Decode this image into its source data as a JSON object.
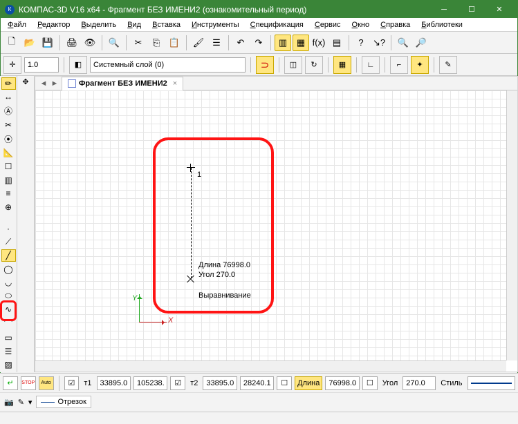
{
  "window": {
    "title": "КОМПАС-3D V16  x64 - Фрагмент БЕЗ ИМЕНИ2 (ознакомительный период)"
  },
  "menu": {
    "items": [
      "Файл",
      "Редактор",
      "Выделить",
      "Вид",
      "Вставка",
      "Инструменты",
      "Спецификация",
      "Сервис",
      "Окно",
      "Справка",
      "Библиотеки"
    ]
  },
  "row2": {
    "scale_value": "1.0",
    "layer_value": "Системный слой (0)"
  },
  "tab": {
    "label": "Фрагмент БЕЗ ИМЕНИ2",
    "close": "×"
  },
  "canvas": {
    "indicator": "1",
    "length_label": "Длина 76998.0",
    "angle_label": "Угол 270.0",
    "align_label": "Выравнивание",
    "axis_x": "X",
    "axis_y": "Y"
  },
  "props": {
    "t1_label": "т1",
    "t1_x": "33895.0",
    "t1_y": "105238.",
    "t2_label": "т2",
    "t2_x": "33895.0",
    "t2_y": "28240.1",
    "len_label": "Длина",
    "len_val": "76998.0",
    "ang_label": "Угол",
    "ang_val": "270.0",
    "style_label": "Стиль",
    "segment_label": "Отрезок"
  },
  "status": {
    "text": " "
  },
  "icons": {
    "stop": "STOP",
    "auto": "Auto",
    "fx": "f(x)",
    "help": "?",
    "arrowhelp": "⤴?"
  }
}
